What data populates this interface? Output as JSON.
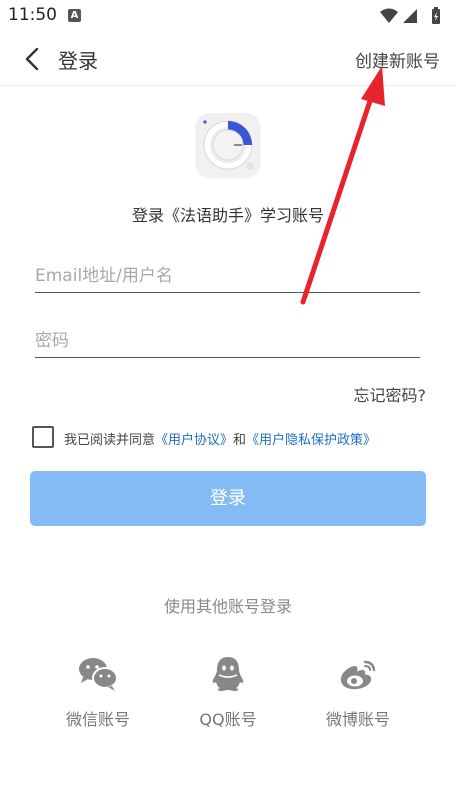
{
  "status_bar": {
    "time": "11:50",
    "notification_icon": "A"
  },
  "nav": {
    "title": "登录",
    "create_account": "创建新账号"
  },
  "heading": "登录《法语助手》学习账号",
  "form": {
    "username_placeholder": "Email地址/用户名",
    "password_placeholder": "密码",
    "forgot_password": "忘记密码?"
  },
  "agreement": {
    "prefix": "我已阅读并同意",
    "user_agreement": "《用户协议》",
    "and": "和",
    "privacy_policy": "《用户隐私保护政策》",
    "checked": false
  },
  "login_button": "登录",
  "other_login": {
    "title": "使用其他账号登录",
    "options": [
      {
        "label": "微信账号",
        "icon": "wechat-icon"
      },
      {
        "label": "QQ账号",
        "icon": "qq-icon"
      },
      {
        "label": "微博账号",
        "icon": "weibo-icon"
      }
    ]
  },
  "colors": {
    "accent_button": "#84bbf5",
    "link": "#1e6fc6",
    "annotation_arrow": "#e8232a"
  }
}
